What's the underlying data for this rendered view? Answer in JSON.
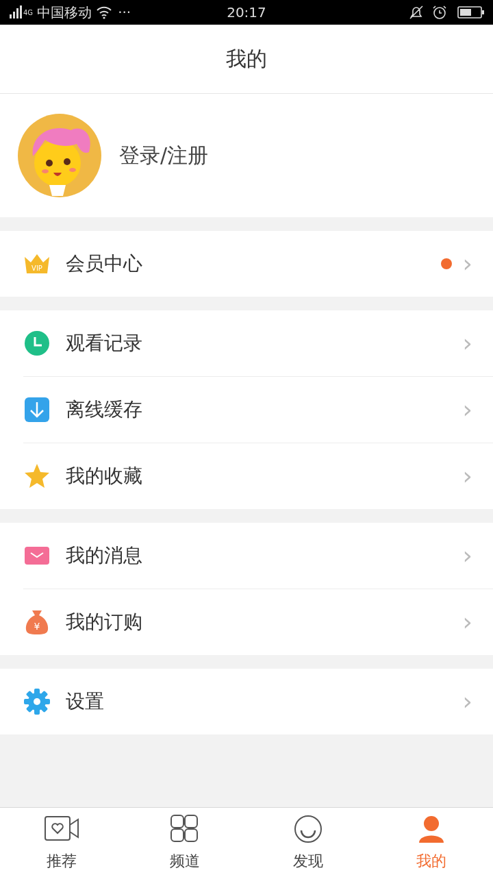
{
  "status_bar": {
    "network": "4G",
    "carrier": "中国移动",
    "more": "···",
    "time": "20:17"
  },
  "header": {
    "title": "我的"
  },
  "profile": {
    "login_label": "登录/注册"
  },
  "sections": [
    {
      "items": [
        {
          "kind": "vip",
          "icon_text": "VIP",
          "label": "会员中心",
          "dot": true,
          "chevron": "›"
        }
      ]
    },
    {
      "items": [
        {
          "kind": "history",
          "label": "观看记录",
          "dot": false,
          "chevron": "›"
        },
        {
          "kind": "download",
          "label": "离线缓存",
          "dot": false,
          "chevron": "›"
        },
        {
          "kind": "favorite",
          "label": "我的收藏",
          "dot": false,
          "chevron": "›"
        }
      ]
    },
    {
      "items": [
        {
          "kind": "message",
          "label": "我的消息",
          "dot": false,
          "chevron": "›"
        },
        {
          "kind": "order",
          "icon_text": "¥",
          "label": "我的订购",
          "dot": false,
          "chevron": "›"
        }
      ]
    },
    {
      "items": [
        {
          "kind": "settings",
          "label": "设置",
          "dot": false,
          "chevron": "›"
        }
      ]
    }
  ],
  "tab_bar": [
    {
      "kind": "recommend",
      "label": "推荐",
      "selected": false
    },
    {
      "kind": "channels",
      "label": "频道",
      "selected": false
    },
    {
      "kind": "discover",
      "label": "发现",
      "selected": false
    },
    {
      "kind": "me",
      "label": "我的",
      "selected": true
    }
  ]
}
